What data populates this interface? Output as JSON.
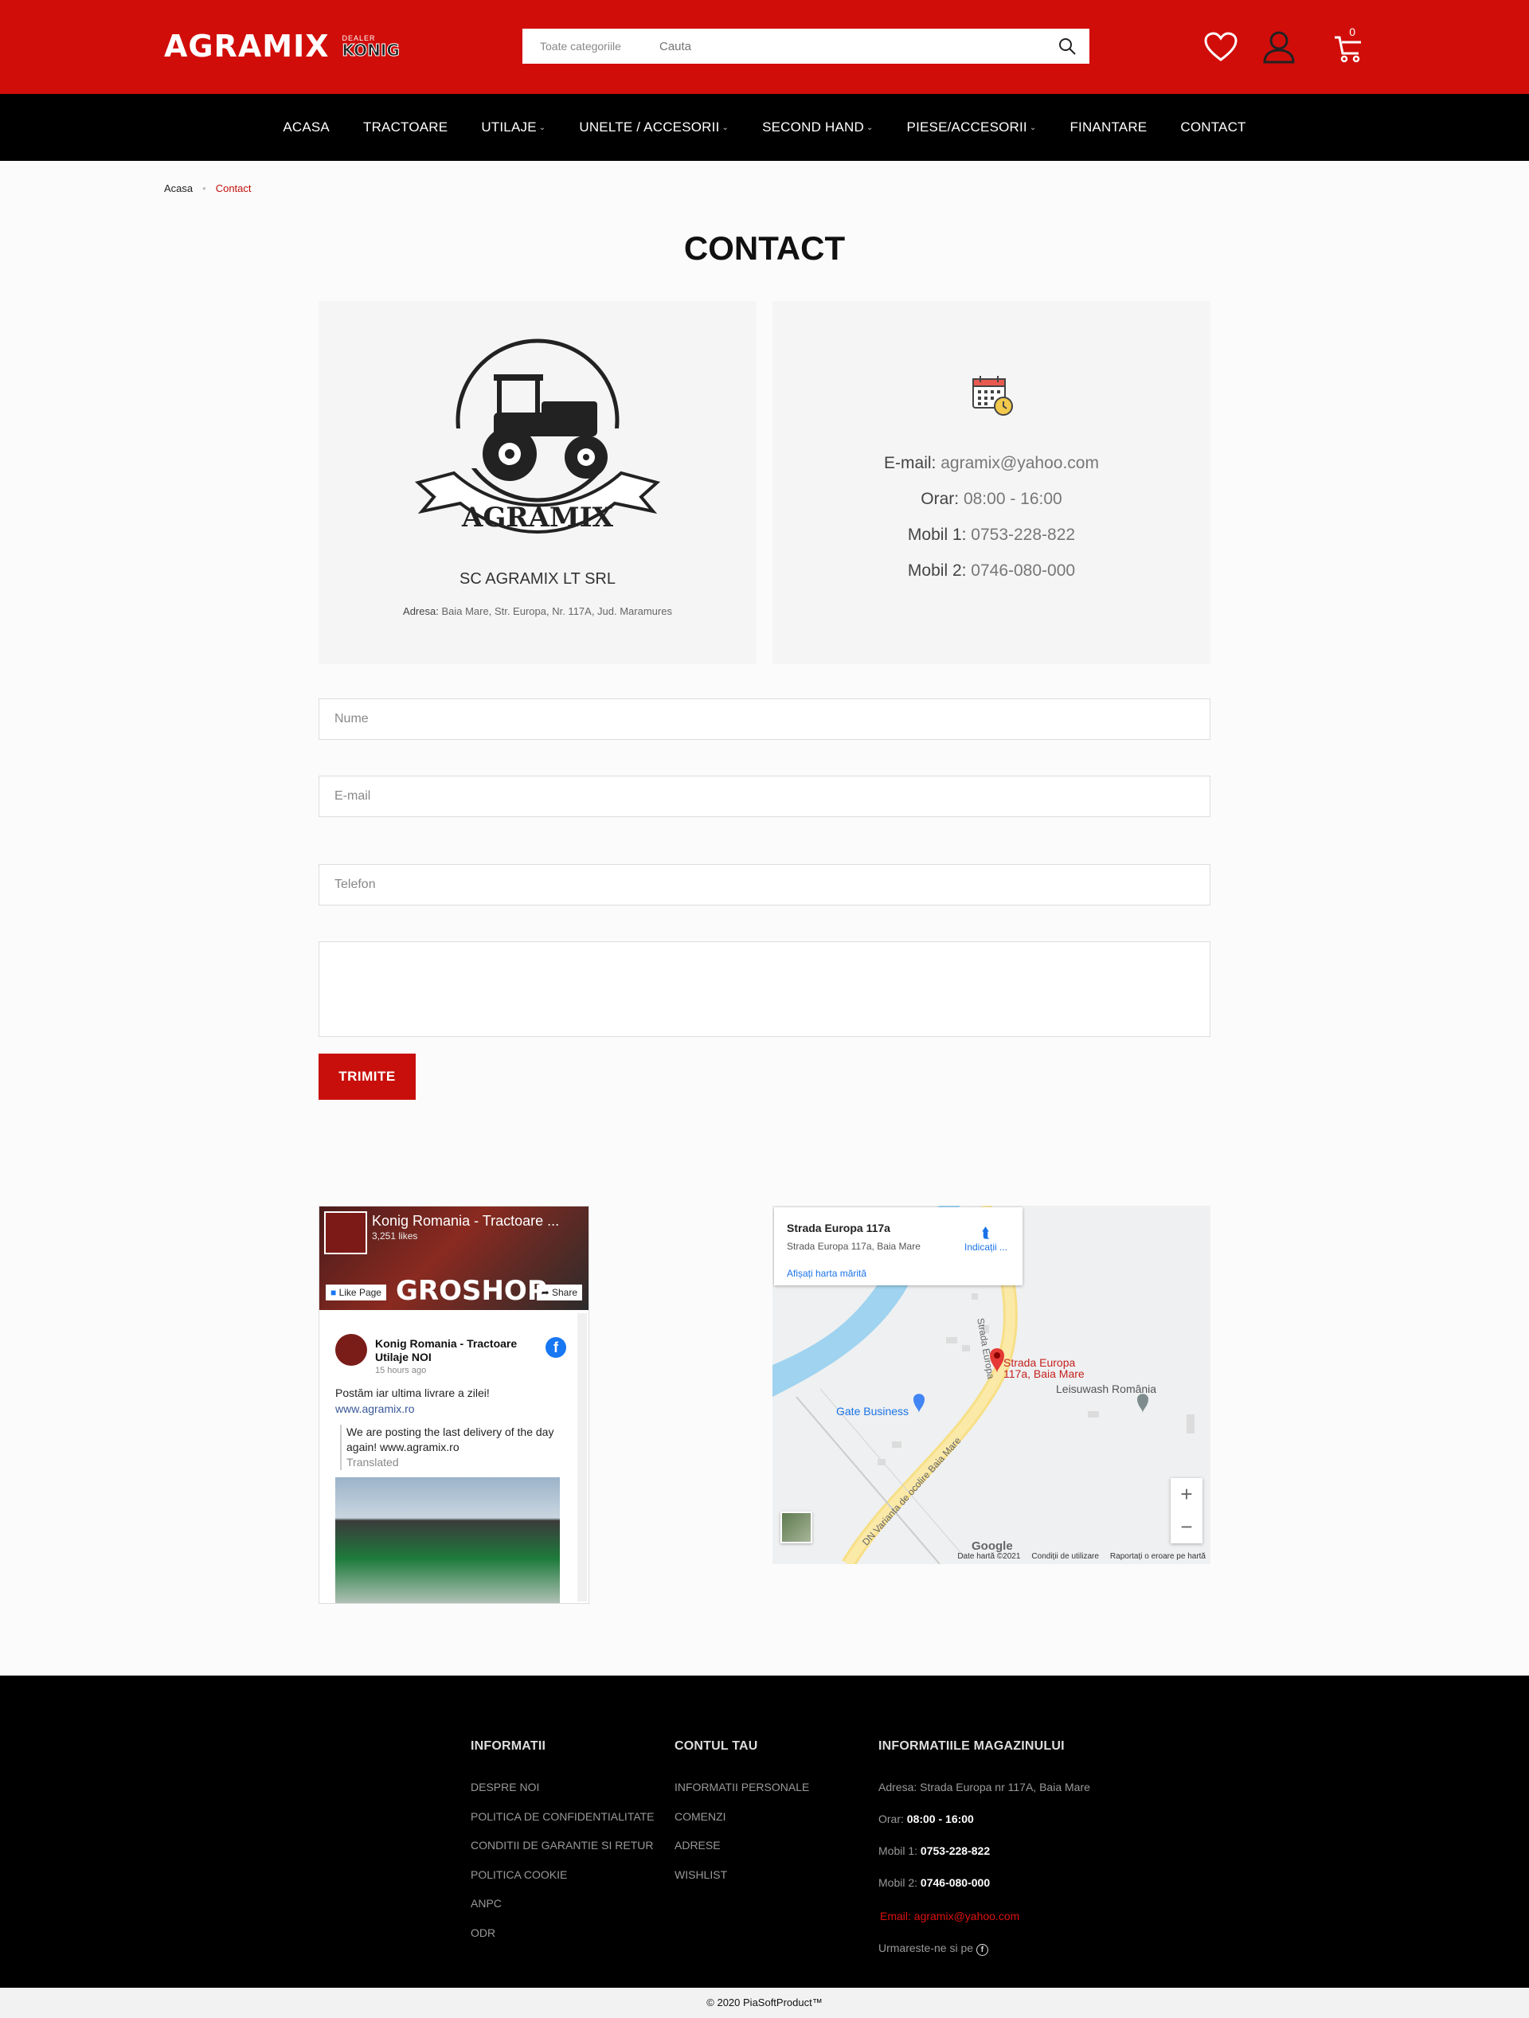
{
  "header": {
    "logo_main": "AGRAMIX",
    "logo_small": "DEALER",
    "logo_brand": "KONIG",
    "search_category": "Toate categoriile",
    "search_placeholder": "Cauta",
    "cart_count": "0"
  },
  "nav": [
    {
      "label": "ACASA",
      "dropdown": false
    },
    {
      "label": "TRACTOARE",
      "dropdown": false
    },
    {
      "label": "UTILAJE",
      "dropdown": true
    },
    {
      "label": "UNELTE / ACCESORII",
      "dropdown": true
    },
    {
      "label": "SECOND HAND",
      "dropdown": true
    },
    {
      "label": "PIESE/ACCESORII",
      "dropdown": true
    },
    {
      "label": "FINANTARE",
      "dropdown": false
    },
    {
      "label": "CONTACT",
      "dropdown": false
    }
  ],
  "breadcrumb": {
    "home": "Acasa",
    "current": "Contact"
  },
  "page_title": "CONTACT",
  "company": {
    "logo_text": "AGRAMIX",
    "name": "SC AGRAMIX LT SRL",
    "address_label": "Adresa:",
    "address": "Baia Mare, Str. Europa, Nr. 117A, Jud. Maramures"
  },
  "contact_info": {
    "email_label": "E-mail:",
    "email": "agramix@yahoo.com",
    "hours_label": "Orar:",
    "hours": "08:00 - 16:00",
    "mobile1_label": "Mobil 1:",
    "mobile1": "0753-228-822",
    "mobile2_label": "Mobil 2:",
    "mobile2": "0746-080-000"
  },
  "form": {
    "name_placeholder": "Nume",
    "email_placeholder": "E-mail",
    "phone_placeholder": "Telefon",
    "submit_label": "TRIMITE"
  },
  "facebook": {
    "page_title": "Konig Romania - Tractoare ...",
    "likes": "3,251 likes",
    "like_label": "Like Page",
    "share_label": "Share",
    "cover_text": "GROSHOP",
    "post_author": "Konig Romania - Tractoare Utilaje NOI",
    "post_time": "15 hours ago",
    "post_text": "Postăm iar ultima livrare a zilei!",
    "post_link": "www.agramix.ro",
    "translation": "We are posting the last delivery of the day again! www.agramix.ro",
    "translated_label": "Translated"
  },
  "map": {
    "place_title": "Strada Europa 117a",
    "place_address": "Strada Europa 117a, Baia Mare",
    "directions": "Indicații ...",
    "larger_map": "Afișați harta mărită",
    "pin_label_1": "Strada Europa",
    "pin_label_2": "117a, Baia Mare",
    "poi_1": "Leisuwash România",
    "poi_2": "Gate Business",
    "road_1": "Strada Europa",
    "road_2": "DN Varianta de ocolire Baia Mare",
    "google": "Google",
    "data": "Date hartă ©2021",
    "terms": "Condiții de utilizare",
    "report": "Raportați o eroare pe hartă",
    "zoom_in": "+",
    "zoom_out": "−"
  },
  "footer": {
    "col1": {
      "title": "INFORMATII",
      "links": [
        "DESPRE NOI",
        "POLITICA DE CONFIDENTIALITATE",
        "CONDITII DE GARANTIE SI RETUR",
        "POLITICA COOKIE",
        "ANPC",
        "ODR"
      ]
    },
    "col2": {
      "title": "CONTUL TAU",
      "links": [
        "INFORMATII PERSONALE",
        "COMENZI",
        "ADRESE",
        "WISHLIST"
      ]
    },
    "col3": {
      "title": "INFORMATIILE MAGAZINULUI",
      "address": "Adresa: Strada Europa nr 117A, Baia Mare",
      "hours_label": "Orar:",
      "hours": "08:00 - 16:00",
      "m1_label": "Mobil 1:",
      "m1": "0753-228-822",
      "m2_label": "Mobil 2:",
      "m2": "0746-080-000",
      "email": "Email: agramix@yahoo.com",
      "follow": "Urmareste-ne si pe"
    }
  },
  "copyright": "© 2020 PiaSoftProduct™"
}
